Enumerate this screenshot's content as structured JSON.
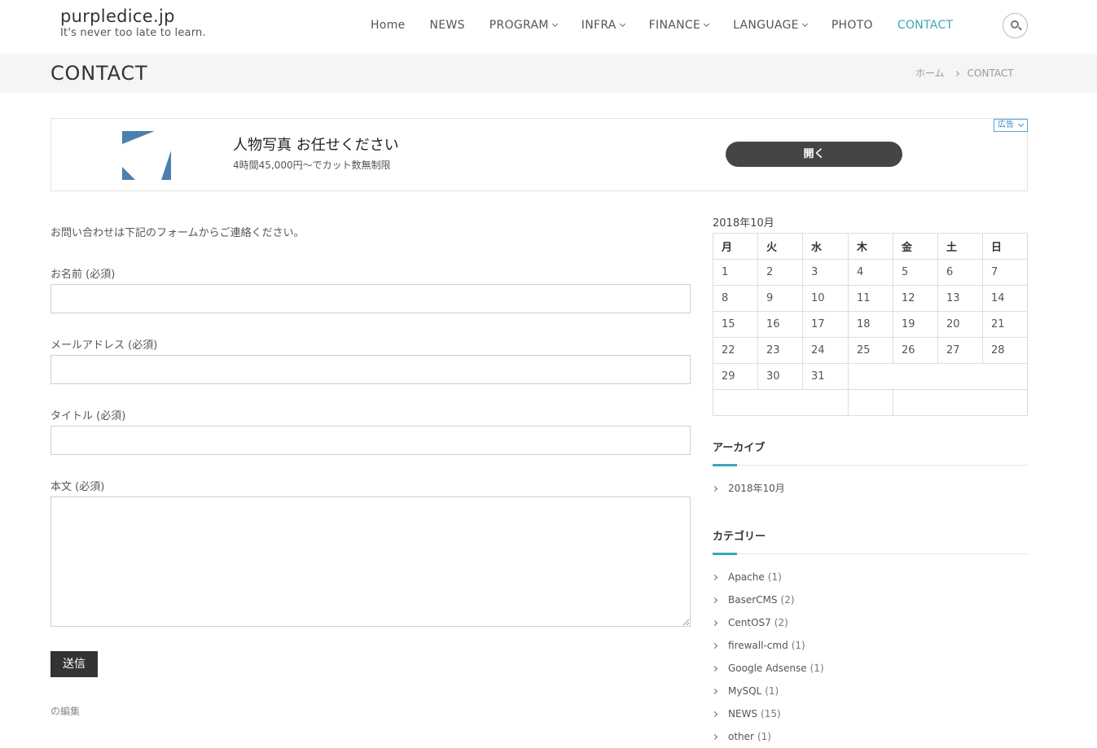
{
  "site": {
    "title": "purpledice.jp",
    "tagline": "It's never too late to learn."
  },
  "nav": {
    "items": [
      {
        "label": "Home",
        "dropdown": false,
        "active": false
      },
      {
        "label": "NEWS",
        "dropdown": false,
        "active": false
      },
      {
        "label": "PROGRAM",
        "dropdown": true,
        "active": false
      },
      {
        "label": "INFRA",
        "dropdown": true,
        "active": false
      },
      {
        "label": "FINANCE",
        "dropdown": true,
        "active": false
      },
      {
        "label": "LANGUAGE",
        "dropdown": true,
        "active": false
      },
      {
        "label": "PHOTO",
        "dropdown": false,
        "active": false
      },
      {
        "label": "CONTACT",
        "dropdown": false,
        "active": true
      }
    ],
    "search_icon": "search-icon"
  },
  "page": {
    "title": "CONTACT",
    "breadcrumb": [
      "ホーム",
      "CONTACT"
    ]
  },
  "ad": {
    "headline": "人物写真 お任せください",
    "subtext": "4時間45,000円～でカット数無制限",
    "button": "開く",
    "badge": "広告",
    "logo_color": "#4a7fb0"
  },
  "form": {
    "intro": "お問い合わせは下記のフォームからご連絡ください。",
    "fields": {
      "name_label": "お名前 (必須)",
      "email_label": "メールアドレス (必須)",
      "title_label": "タイトル (必須)",
      "body_label": "本文 (必須)"
    },
    "values": {
      "name": "",
      "email": "",
      "title": "",
      "body": ""
    },
    "submit": "送信",
    "edit_link": "の編集"
  },
  "calendar": {
    "caption": "2018年10月",
    "weekdays": [
      "月",
      "火",
      "水",
      "木",
      "金",
      "土",
      "日"
    ],
    "weeks": [
      [
        "1",
        "2",
        "3",
        "4",
        "5",
        "6",
        "7"
      ],
      [
        "8",
        "9",
        "10",
        "11",
        "12",
        "13",
        "14"
      ],
      [
        "15",
        "16",
        "17",
        "18",
        "19",
        "20",
        "21"
      ],
      [
        "22",
        "23",
        "24",
        "25",
        "26",
        "27",
        "28"
      ],
      [
        "29",
        "30",
        "31"
      ]
    ]
  },
  "archive": {
    "title": "アーカイブ",
    "items": [
      "2018年10月"
    ]
  },
  "categories": {
    "title": "カテゴリー",
    "items": [
      {
        "name": "Apache",
        "count": "(1)"
      },
      {
        "name": "BaserCMS",
        "count": "(2)"
      },
      {
        "name": "CentOS7",
        "count": "(2)"
      },
      {
        "name": "firewall-cmd",
        "count": "(1)"
      },
      {
        "name": "Google Adsense",
        "count": "(1)"
      },
      {
        "name": "MySQL",
        "count": "(1)"
      },
      {
        "name": "NEWS",
        "count": "(15)"
      },
      {
        "name": "other",
        "count": "(1)"
      }
    ]
  },
  "colors": {
    "accent": "#3aa7b4",
    "button_dark": "#333333"
  }
}
